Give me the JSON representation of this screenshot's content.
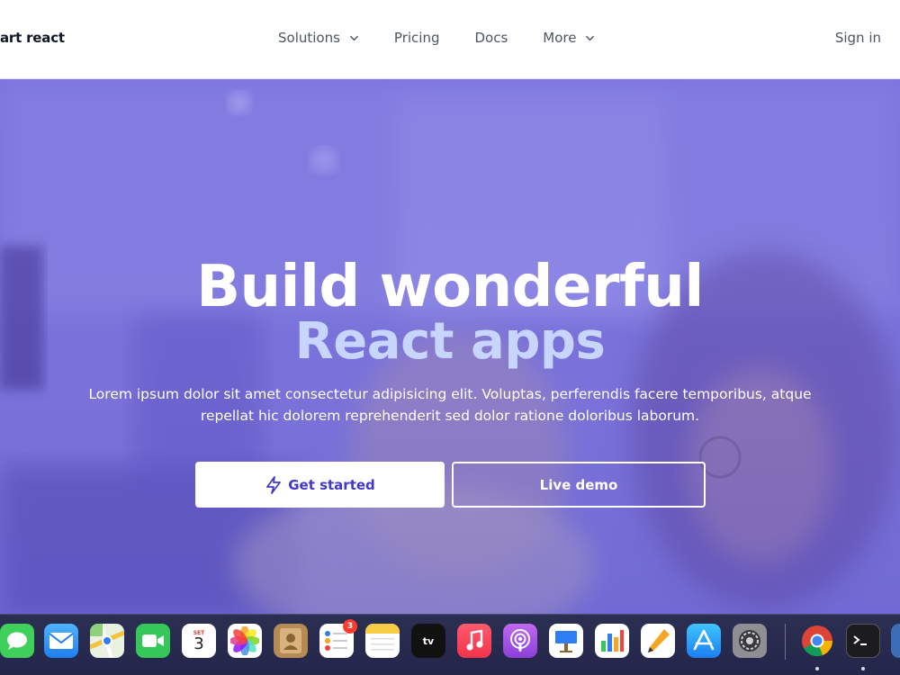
{
  "nav": {
    "brand": "art react",
    "items": [
      {
        "label": "Solutions",
        "has_dropdown": true
      },
      {
        "label": "Pricing",
        "has_dropdown": false
      },
      {
        "label": "Docs",
        "has_dropdown": false
      },
      {
        "label": "More",
        "has_dropdown": true
      }
    ],
    "signin": "Sign in"
  },
  "hero": {
    "title_line1": "Build wonderful",
    "title_line2": "React apps",
    "subtitle": "Lorem ipsum dolor sit amet consectetur adipisicing elit. Voluptas, perferendis facere temporibus, atque repellat hic dolorem reprehenderit sed dolor ratione doloribus laborum.",
    "primary_button": "Get started",
    "secondary_button": "Live demo",
    "primary_icon": "lightning-icon"
  },
  "dock": {
    "apps": [
      {
        "name": "Messages",
        "icon": "messages-icon"
      },
      {
        "name": "Mail",
        "icon": "mail-icon"
      },
      {
        "name": "Maps",
        "icon": "maps-icon"
      },
      {
        "name": "FaceTime",
        "icon": "facetime-icon"
      },
      {
        "name": "Calendar",
        "icon": "calendar-icon",
        "month": "SET",
        "day": "3"
      },
      {
        "name": "Photos",
        "icon": "photos-icon"
      },
      {
        "name": "Contacts",
        "icon": "contacts-icon"
      },
      {
        "name": "Reminders",
        "icon": "reminders-icon",
        "badge": "3"
      },
      {
        "name": "Notes",
        "icon": "notes-icon"
      },
      {
        "name": "Apple TV",
        "icon": "tv-icon",
        "label": "tv"
      },
      {
        "name": "Music",
        "icon": "music-icon"
      },
      {
        "name": "Podcasts",
        "icon": "podcasts-icon"
      },
      {
        "name": "Keynote",
        "icon": "keynote-icon"
      },
      {
        "name": "Numbers",
        "icon": "numbers-icon"
      },
      {
        "name": "Pages",
        "icon": "pages-icon"
      },
      {
        "name": "App Store",
        "icon": "app-store-icon"
      },
      {
        "name": "System Preferences",
        "icon": "system-preferences-icon"
      },
      {
        "name": "Chrome",
        "icon": "chrome-icon"
      },
      {
        "name": "Terminal",
        "icon": "terminal-icon"
      }
    ]
  },
  "colors": {
    "accent": "#4338ca",
    "hero_overlay": "#6e67dc",
    "title_highlight": "#c8d6ff"
  }
}
